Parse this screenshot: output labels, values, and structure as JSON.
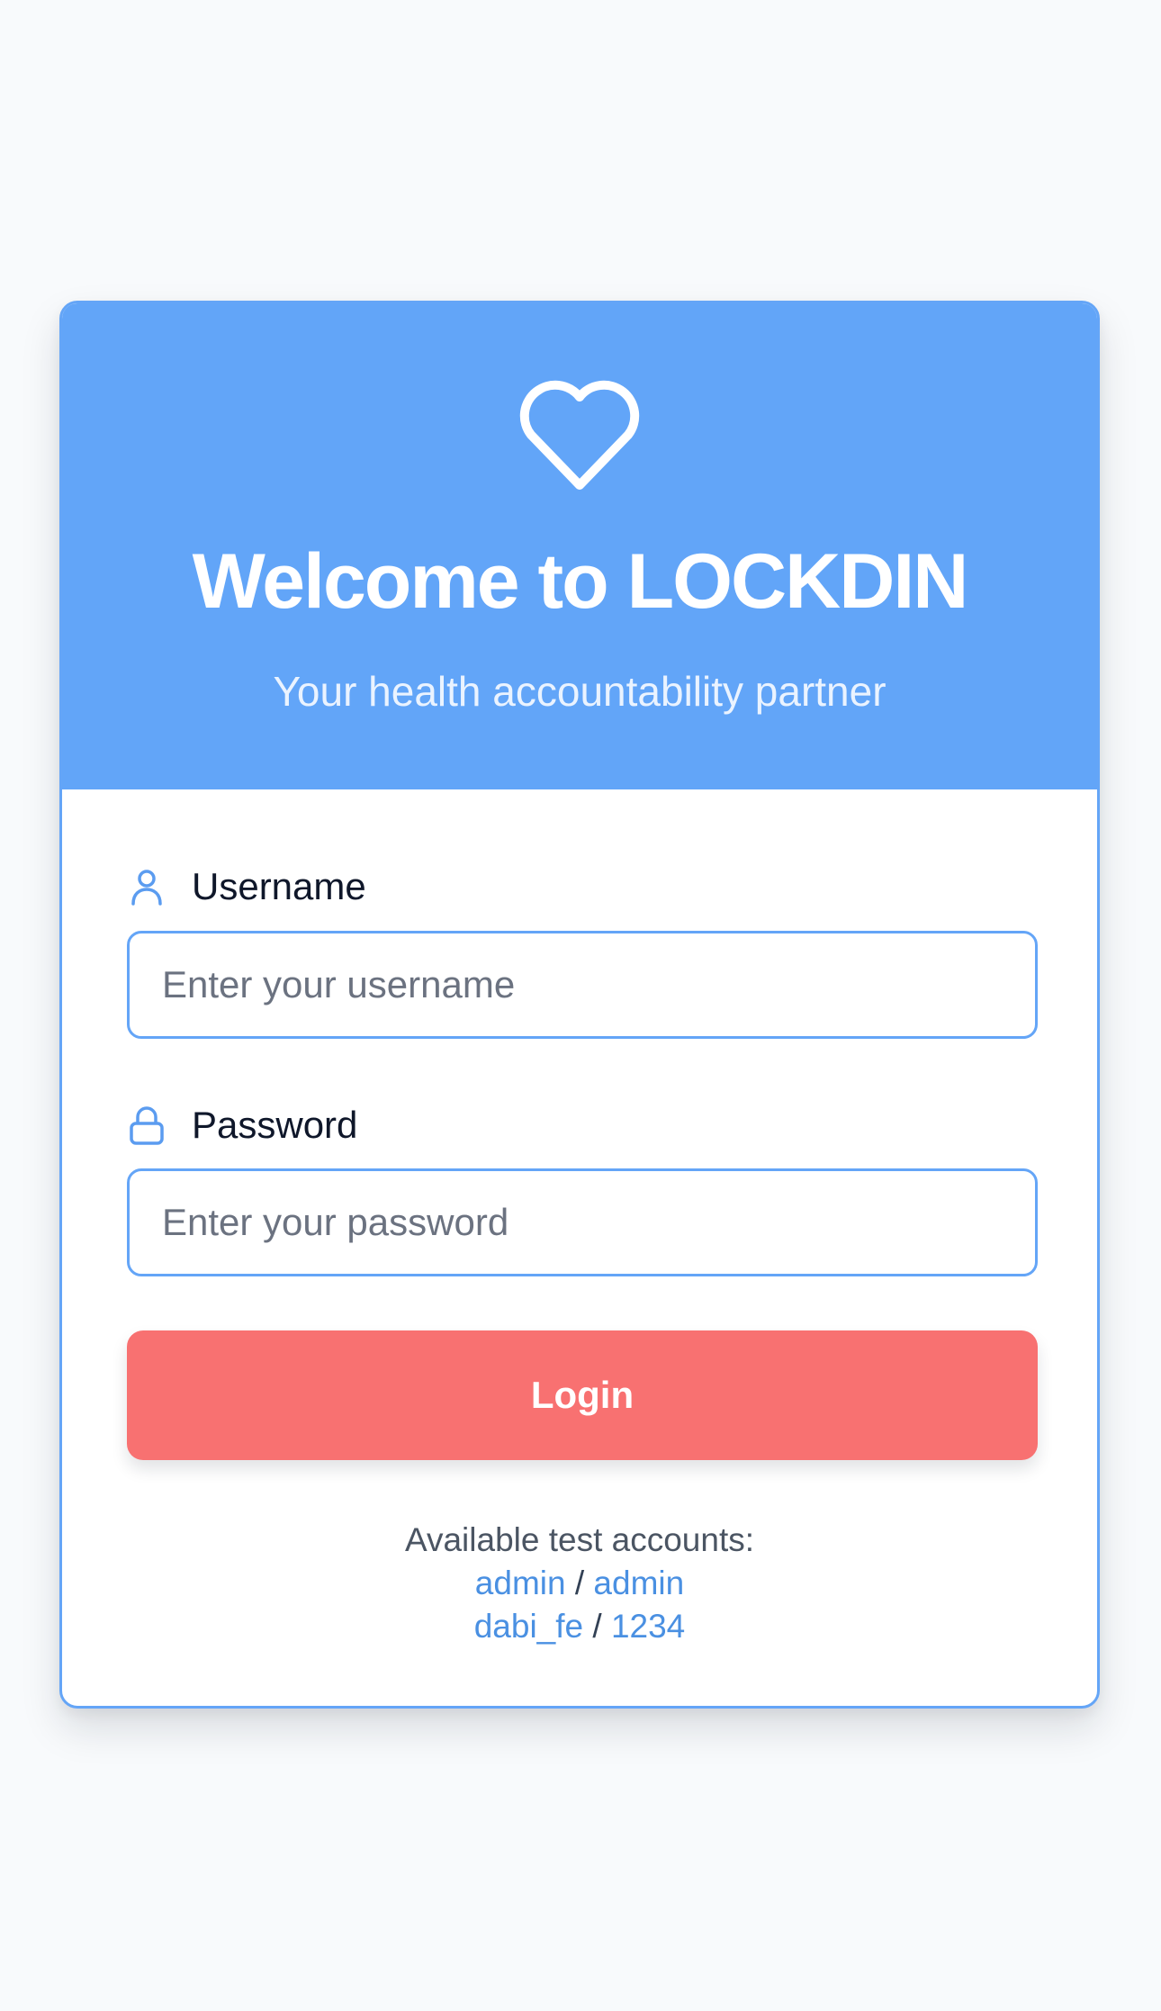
{
  "colors": {
    "page_background": "#f8fafc",
    "header_background": "#62a5f8",
    "accent_blue": "#64a5f7",
    "login_button": "#f87171",
    "link": "#4a90e2"
  },
  "header": {
    "icon": "heart-icon",
    "title": "Welcome to LOCKDIN",
    "subtitle": "Your health accountability partner"
  },
  "form": {
    "username": {
      "icon": "user-icon",
      "label": "Username",
      "value": "",
      "placeholder": "Enter your username"
    },
    "password": {
      "icon": "lock-icon",
      "label": "Password",
      "value": "",
      "placeholder": "Enter your password"
    },
    "login_label": "Login"
  },
  "test_accounts": {
    "heading": "Available test accounts:",
    "separator": "/",
    "accounts": [
      {
        "username": "admin",
        "password": "admin"
      },
      {
        "username": "dabi_fe",
        "password": "1234"
      }
    ]
  }
}
